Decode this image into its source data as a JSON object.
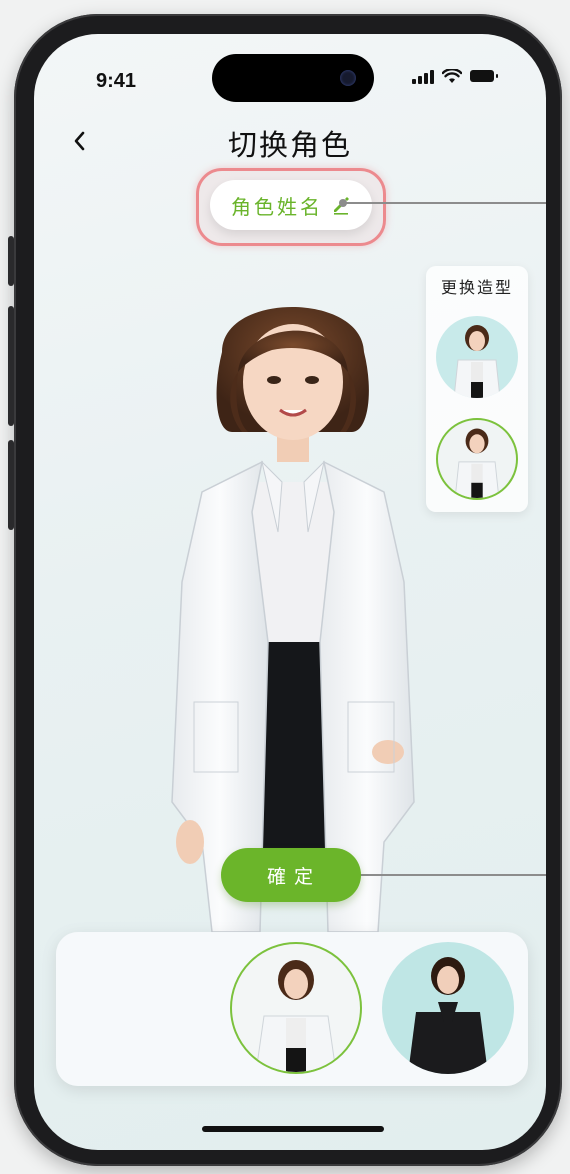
{
  "status_bar": {
    "time": "9:41"
  },
  "header": {
    "title": "切换角色",
    "back_icon": "chevron-left-icon"
  },
  "name_pill": {
    "label": "角色姓名",
    "edit_icon": "pencil-icon",
    "accent": "#6ab42b",
    "highlight": "#ec8a8e"
  },
  "style_panel": {
    "title": "更换造型",
    "items": [
      {
        "name": "white-blazer-look",
        "selected": false
      },
      {
        "name": "white-coat-look",
        "selected": true
      }
    ]
  },
  "confirm_button": {
    "label": "確定",
    "color": "#6bb52a"
  },
  "character_tray": {
    "items": [
      {
        "name": "character-white-outfit",
        "selected": true
      },
      {
        "name": "character-black-outfit",
        "selected": false
      }
    ]
  }
}
